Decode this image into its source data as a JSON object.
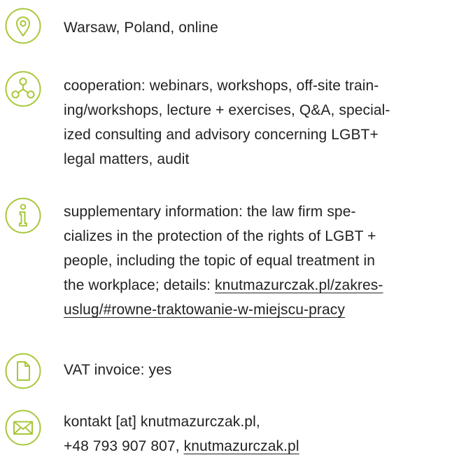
{
  "accent_color": "#a8c83a",
  "text_color": "#222222",
  "entries": [
    {
      "icon": "location-pin-icon",
      "lines": [
        "Warsaw, Poland, online"
      ]
    },
    {
      "icon": "network-icon",
      "lines": [
        "cooperation: webinars, workshops, off-site train-",
        "ing/workshops, lecture + exercises, Q&A, special-",
        "ized consulting and advisory concerning LGBT+",
        "legal matters, audit"
      ]
    },
    {
      "icon": "info-icon",
      "lines": [
        "supplementary information: the law firm spe-",
        "cializes in the protection of the rights of LGBT +",
        "people, including the topic of equal treatment in"
      ],
      "details_prefix": "the workplace; details: ",
      "details_link_part1": "knutmazurczak.pl/zakres-",
      "details_link_part2": "uslug/#rowne-traktowanie-w-miejscu-pracy"
    },
    {
      "icon": "document-icon",
      "lines": [
        "VAT invoice: yes"
      ]
    },
    {
      "icon": "envelope-icon",
      "line1": "kontakt [at] knutmazurczak.pl,",
      "phone": "+48 793 907 807, ",
      "website": "knutmazurczak.pl"
    }
  ]
}
